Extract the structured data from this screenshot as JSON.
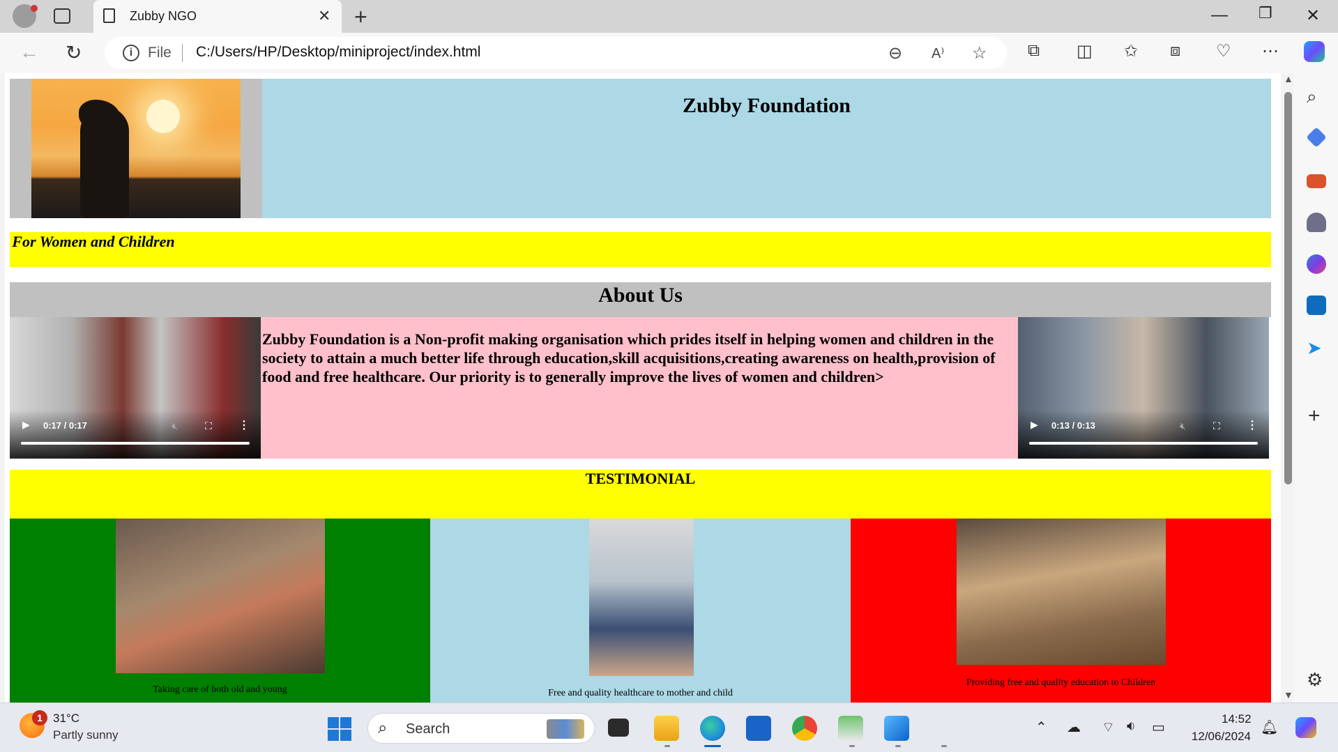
{
  "browser": {
    "tab_title": "Zubby NGO",
    "scheme_label": "File",
    "url": "C:/Users/HP/Desktop/miniproject/index.html",
    "icons": [
      "profile-icon",
      "tab-actions-icon",
      "document-icon",
      "close-icon",
      "new-tab-icon",
      "minimize-icon",
      "restore-icon",
      "window-close-icon",
      "back-icon",
      "refresh-icon",
      "info-icon",
      "zoom-out-icon",
      "read-aloud-icon",
      "favorite-star-icon",
      "extensions-icon",
      "split-screen-icon",
      "favorites-icon",
      "collections-icon",
      "browser-essentials-icon",
      "more-icon",
      "copilot-icon"
    ]
  },
  "sidebar": {
    "icons": [
      "search-icon",
      "shopping-tag-icon",
      "tools-icon",
      "games-icon",
      "microsoft365-icon",
      "outlook-icon",
      "telegram-icon",
      "add-icon",
      "settings-icon"
    ]
  },
  "page": {
    "site_title": "Zubby Foundation",
    "marquee": "y For Women and Children",
    "about_title": "About Us",
    "about_text": "Zubby Foundation is a Non-profit making organisation which prides itself in helping women and children in the society to attain a much better life through education,skill acquisitions,creating awareness on health,provision of food and free healthcare. Our priority is to generally improve the lives of women and children>",
    "video_left": {
      "time": "0:17 / 0:17"
    },
    "video_right": {
      "time": "0:13 / 0:13"
    },
    "testimonial_title": "TESTIMONIAL",
    "testimonials": [
      {
        "caption": "Taking care of both old and young",
        "bg": "#008000",
        "caption_color": "#000000"
      },
      {
        "caption": "Free and quality healthcare to mother and child",
        "bg": "#add8e6",
        "caption_color": "#000000"
      },
      {
        "caption": "Providing free and quality education to Children",
        "bg": "#ff0000",
        "caption_color": "#000000"
      }
    ]
  },
  "colors": {
    "header_gray": "#c0c0c0",
    "light_blue": "#add8e6",
    "yellow": "#ffff00",
    "pink": "#ffc0cb"
  },
  "taskbar": {
    "weather_badge": "1",
    "temperature": "31°C",
    "condition": "Partly sunny",
    "search_label": "Search",
    "time": "14:52",
    "date": "12/06/2024",
    "apps": [
      "windows-start-icon",
      "search-icon",
      "task-view-icon",
      "file-explorer-icon",
      "edge-icon",
      "store-icon",
      "chrome-icon",
      "notepad-icon",
      "photos-icon"
    ],
    "tray_icons": [
      "chevron-up-icon",
      "onedrive-icon",
      "wifi-icon",
      "volume-icon",
      "battery-icon",
      "notifications-bell-icon",
      "copilot-pre-icon"
    ]
  }
}
